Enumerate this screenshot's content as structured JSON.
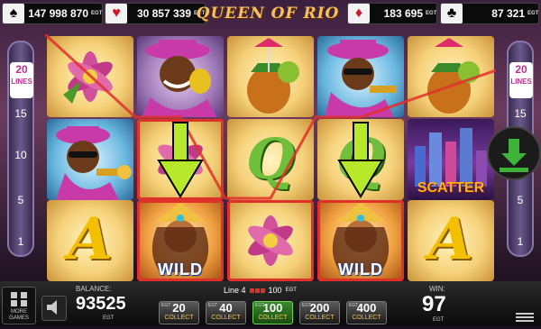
{
  "jackpots": [
    {
      "suit": "♠",
      "color": "#000000",
      "value": "147 998 870",
      "egt": "EGT"
    },
    {
      "suit": "♥",
      "color": "#d0182a",
      "value": "30 857 339",
      "egt": "EGT"
    },
    {
      "suit": "♦",
      "color": "#d0182a",
      "value": "183 695",
      "egt": "EGT"
    },
    {
      "suit": "♣",
      "color": "#000000",
      "value": "87 321",
      "egt": "EGT"
    }
  ],
  "title": "QUEEN OF RIO",
  "lines_left": {
    "count": "20",
    "label": "LINES",
    "marks": [
      "15",
      "10",
      "5",
      "1"
    ]
  },
  "lines_right": {
    "count": "20",
    "label": "LINES",
    "marks": [
      "15",
      "10",
      "5",
      "1"
    ]
  },
  "symbols": {
    "wild": "WILD",
    "scatter": "SCATTER",
    "letter_a": "A",
    "letter_q": "Q"
  },
  "bottom": {
    "balance_label": "BALANCE:",
    "balance": "93525",
    "balance_egt": "EGT",
    "more_games": "MORE GAMES",
    "line_info": "Line 4",
    "line_win": "100",
    "line_win_egt": "EGT",
    "win_label": "WIN:",
    "win": "97",
    "win_egt": "EGT",
    "chips": [
      {
        "value": "20",
        "label": "COLLECT",
        "egt": "EGT",
        "active": false
      },
      {
        "value": "40",
        "label": "COLLECT",
        "egt": "EGT",
        "active": false
      },
      {
        "value": "100",
        "label": "COLLECT",
        "egt": "EGT",
        "active": true
      },
      {
        "value": "200",
        "label": "COLLECT",
        "egt": "EGT",
        "active": false
      },
      {
        "value": "400",
        "label": "COLLECT",
        "egt": "EGT",
        "active": false
      }
    ]
  },
  "colors": {
    "accent_gold": "#f3c25a",
    "win_line": "#e0302a",
    "arrow_green": "#b8e82a"
  }
}
